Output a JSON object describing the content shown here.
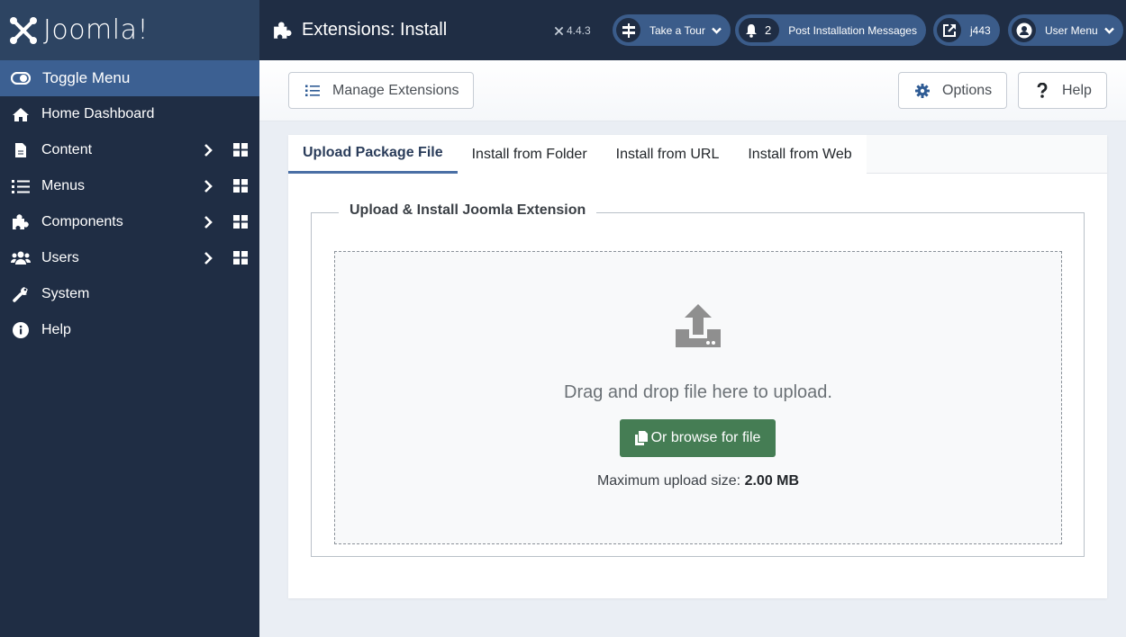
{
  "brand": {
    "name": "Joomla!"
  },
  "sidebar": {
    "toggle_label": "Toggle Menu",
    "items": [
      {
        "label": "Home Dashboard",
        "icon": "home-icon",
        "has_submenu": false
      },
      {
        "label": "Content",
        "icon": "file-icon",
        "has_submenu": true
      },
      {
        "label": "Menus",
        "icon": "list-icon",
        "has_submenu": true
      },
      {
        "label": "Components",
        "icon": "puzzle-icon",
        "has_submenu": true
      },
      {
        "label": "Users",
        "icon": "users-icon",
        "has_submenu": true
      },
      {
        "label": "System",
        "icon": "wrench-icon",
        "has_submenu": false
      },
      {
        "label": "Help",
        "icon": "info-icon",
        "has_submenu": false
      }
    ]
  },
  "header": {
    "title": "Extensions: Install",
    "version": "4.4.3",
    "take_tour": "Take a Tour",
    "post_install_count": "2",
    "post_install_label": "Post Installation Messages",
    "site_link": "j443",
    "user_menu": "User Menu"
  },
  "toolbar": {
    "manage_extensions": "Manage Extensions",
    "options": "Options",
    "help": "Help"
  },
  "tabs": [
    {
      "label": "Upload Package File",
      "active": true
    },
    {
      "label": "Install from Folder",
      "active": false
    },
    {
      "label": "Install from URL",
      "active": false
    },
    {
      "label": "Install from Web",
      "active": false
    }
  ],
  "upload": {
    "legend": "Upload & Install Joomla Extension",
    "drop_text": "Drag and drop file here to upload.",
    "browse_label": "Or browse for file",
    "max_size_label": "Maximum upload size:",
    "max_size_value": "2.00 MB"
  },
  "colors": {
    "sidebar_bg": "#1f2d44",
    "accent": "#3c6092",
    "success": "#457d54"
  }
}
